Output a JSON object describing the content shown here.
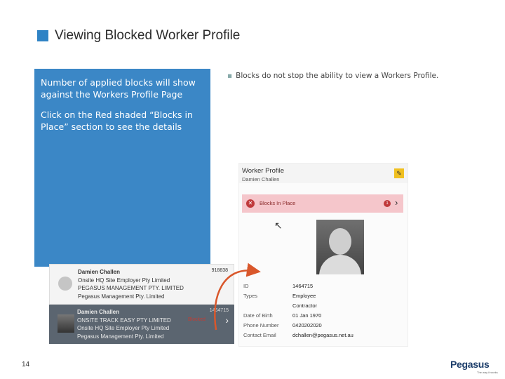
{
  "slide": {
    "title": "Viewing Blocked Worker Profile",
    "panel_text": [
      "Number of applied blocks will show against the Workers Profile Page",
      "Click on the Red shaded “Blocks in Place” section to see the details"
    ],
    "bullet": "Blocks do not stop the ability to view a Workers Profile.",
    "page_number": "14",
    "logo": "Pegasus",
    "logo_tagline": "The way it works"
  },
  "profile": {
    "title": "Worker Profile",
    "name": "Damien Challen",
    "blocks_label": "Blocks In Place",
    "blocks_count": "1",
    "fields": [
      {
        "label": "ID",
        "value": "1464715"
      },
      {
        "label": "Types",
        "value": "Employee"
      },
      {
        "label": "",
        "value": "Contractor"
      },
      {
        "label": "Date of Birth",
        "value": "01 Jan 1970"
      },
      {
        "label": "Phone Number",
        "value": "0420202020"
      },
      {
        "label": "Contact Email",
        "value": "dchallen@pegasus.net.au"
      }
    ]
  },
  "workers": [
    {
      "name": "Damien Challen",
      "id": "918838",
      "lines": [
        "Onsite HQ Site Employer Pty Limited",
        "PEGASUS MANAGEMENT PTY. LIMITED",
        "Pegasus Management Pty. Limited"
      ]
    },
    {
      "name": "Damien Challen",
      "id": "1464715",
      "blocked": "Blocked",
      "lines": [
        "ONSITE TRACK EASY PTY LIMITED",
        "Onsite HQ Site Employer Pty Limited",
        "Pegasus Management Pty. Limited"
      ]
    }
  ],
  "icons": {
    "edit": "pencil-icon",
    "blocks": "x-circle-icon",
    "chevron": "chevron-right-icon",
    "cursor": "mouse-cursor-icon"
  },
  "colors": {
    "accent": "#3b87c6",
    "blocks_bg": "#f5c6cb",
    "block_red": "#c0393b",
    "selected_row": "#5b6570",
    "arrow": "#d9572b"
  }
}
